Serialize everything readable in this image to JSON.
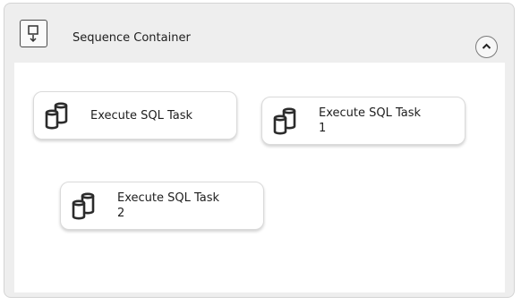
{
  "container": {
    "title": "Sequence Container",
    "icon": "sequence-container-icon",
    "collapse_icon": "chevron-up-icon"
  },
  "tasks": [
    {
      "line1": "Execute SQL Task",
      "line2": "",
      "icon": "database-icon"
    },
    {
      "line1": "Execute SQL Task",
      "line2": "1",
      "icon": "database-icon"
    },
    {
      "line1": "Execute SQL Task",
      "line2": "2",
      "icon": "database-icon"
    }
  ],
  "colors": {
    "container_background": "#eeeeee",
    "canvas_background": "#ffffff",
    "task_border": "#dadada",
    "icon_stroke": "#2b2b2b"
  }
}
